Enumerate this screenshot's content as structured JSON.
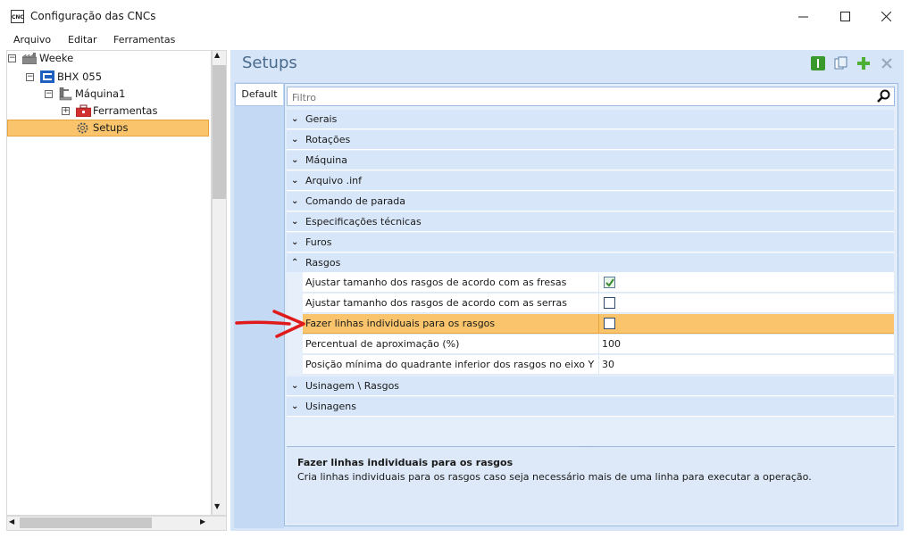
{
  "window": {
    "title": "Configuração das CNCs",
    "app_icon_text": "CNC"
  },
  "menu": [
    "Arquivo",
    "Editar",
    "Ferramentas"
  ],
  "tree": {
    "items": [
      {
        "label": "Weeke"
      },
      {
        "label": "BHX 055"
      },
      {
        "label": "Máquina1"
      },
      {
        "label": "Ferramentas"
      },
      {
        "label": "Setups"
      }
    ],
    "selected": "Setups"
  },
  "panel": {
    "title": "Setups",
    "tab": "Default",
    "filter_placeholder": "Filtro"
  },
  "categories": {
    "gerais": "Gerais",
    "rotacoes": "Rotações",
    "maquina": "Máquina",
    "arquivo_inf": "Arquivo .inf",
    "comando_parada": "Comando de parada",
    "especificacoes": "Especificações técnicas",
    "furos": "Furos",
    "rasgos": "Rasgos",
    "usinagem_rasgos": "Usinagem \\ Rasgos",
    "usinagens": "Usinagens"
  },
  "properties": [
    {
      "name": "Ajustar tamanho dos rasgos de acordo com as fresas",
      "checked": true
    },
    {
      "name": "Ajustar tamanho dos rasgos de acordo com as serras",
      "checked": false
    },
    {
      "name": "Fazer linhas individuais para os rasgos",
      "checked": false
    },
    {
      "name": "Percentual de aproximação (%)",
      "value": "100"
    },
    {
      "name": "Posição mínima do quadrante inferior dos rasgos no eixo Y",
      "value": "30"
    }
  ],
  "description": {
    "title": "Fazer linhas individuais para os rasgos",
    "text": "Cria linhas individuais para os rasgos caso seja necessário mais de uma linha para executar a operação."
  },
  "colors": {
    "selected": "#f9c46b",
    "accent": "#4a6a8c",
    "annotation_arrow": "#e01b1b"
  }
}
